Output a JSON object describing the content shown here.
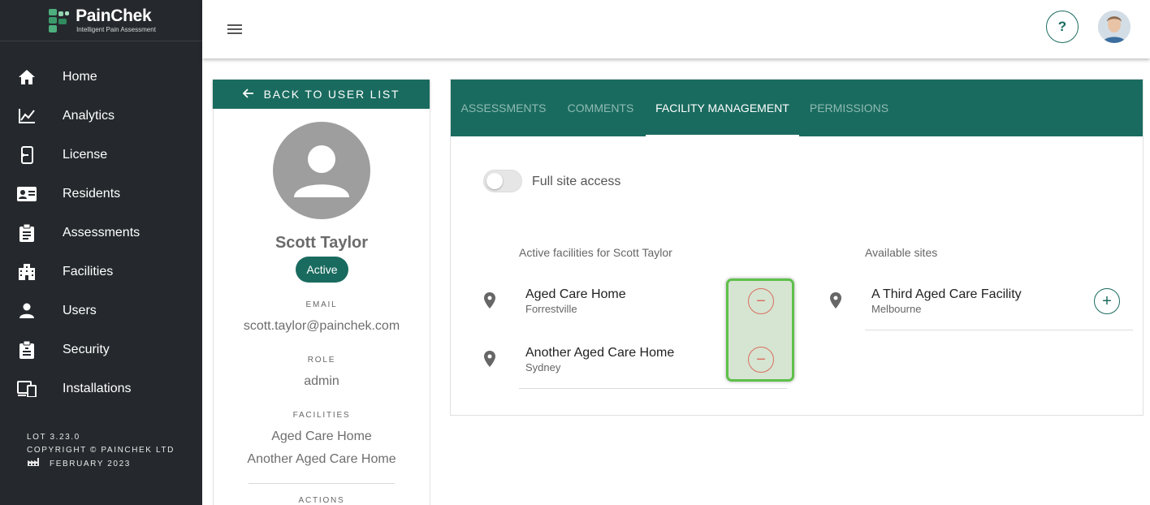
{
  "brand": {
    "name": "PainChek",
    "tagline": "Intelligent Pain Assessment"
  },
  "sidebar": {
    "items": [
      {
        "label": "Home",
        "icon": "home-icon"
      },
      {
        "label": "Analytics",
        "icon": "analytics-icon"
      },
      {
        "label": "License",
        "icon": "license-icon"
      },
      {
        "label": "Residents",
        "icon": "residents-icon"
      },
      {
        "label": "Assessments",
        "icon": "assessments-icon"
      },
      {
        "label": "Facilities",
        "icon": "facilities-icon"
      },
      {
        "label": "Users",
        "icon": "users-icon"
      },
      {
        "label": "Security",
        "icon": "security-icon"
      },
      {
        "label": "Installations",
        "icon": "installations-icon"
      }
    ],
    "footer": {
      "version": "LOT 3.23.0",
      "copyright": "COPYRIGHT © PAINCHEK LTD",
      "build_date": "FEBRUARY 2023"
    }
  },
  "topbar": {
    "help_label": "?"
  },
  "back_button": {
    "label": "BACK TO USER LIST"
  },
  "profile": {
    "name": "Scott Taylor",
    "status": "Active",
    "email_label": "EMAIL",
    "email": "scott.taylor@painchek.com",
    "role_label": "ROLE",
    "role": "admin",
    "facilities_label": "FACILITIES",
    "facilities": [
      "Aged Care Home",
      "Another Aged Care Home"
    ],
    "actions_label": "ACTIONS"
  },
  "tabs": [
    {
      "label": "ASSESSMENTS",
      "active": false
    },
    {
      "label": "COMMENTS",
      "active": false
    },
    {
      "label": "FACILITY MANAGEMENT",
      "active": true
    },
    {
      "label": "PERMISSIONS",
      "active": false
    }
  ],
  "facility_management": {
    "full_site_access_label": "Full site access",
    "full_site_access": false,
    "active_heading": "Active facilities for Scott Taylor",
    "available_heading": "Available sites",
    "active_facilities": [
      {
        "name": "Aged Care Home",
        "location": "Forrestville",
        "action": "−"
      },
      {
        "name": "Another Aged Care Home",
        "location": "Sydney",
        "action": "−"
      }
    ],
    "available_sites": [
      {
        "name": "A Third Aged Care Facility",
        "location": "Melbourne",
        "action": "+"
      }
    ]
  },
  "colors": {
    "primary": "#1a6b5f",
    "sidebar_bg": "#25292d",
    "remove": "#d9705f",
    "highlight_border": "#5ec04a"
  }
}
